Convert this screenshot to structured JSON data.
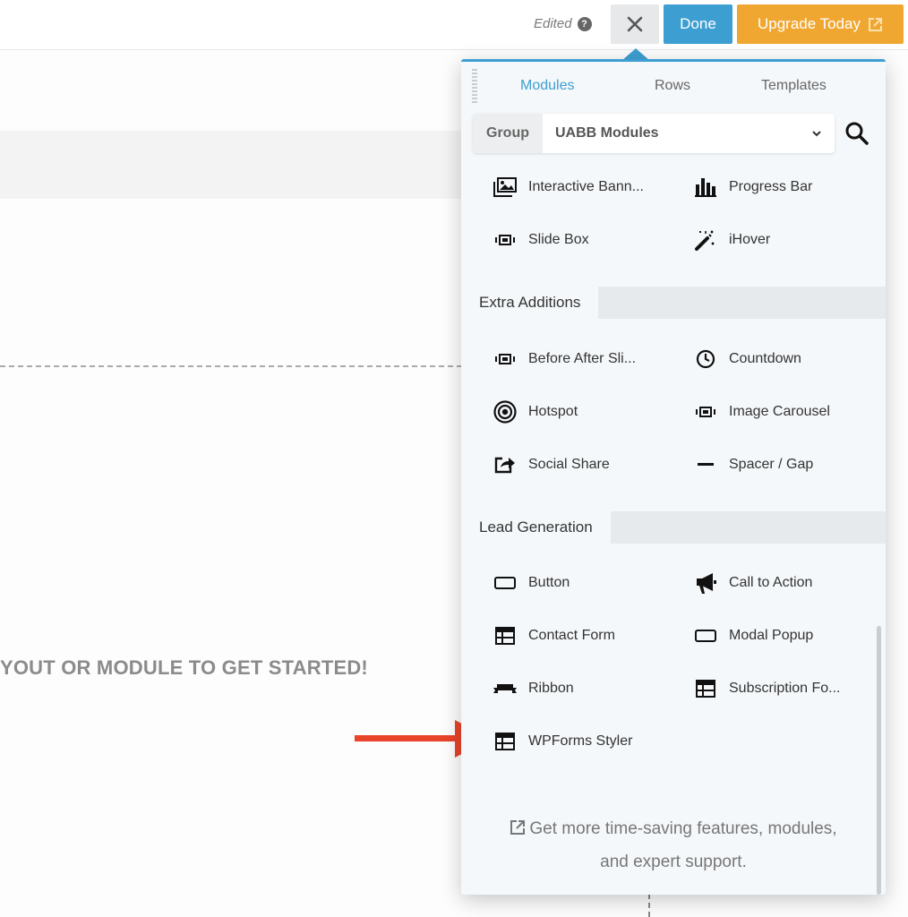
{
  "topbar": {
    "edited_label": "Edited",
    "help_icon_glyph": "?",
    "done_label": "Done",
    "upgrade_label": "Upgrade Today",
    "colors": {
      "done": "#3d9fd1",
      "upgrade": "#f0a732",
      "close": "#e6e8ea"
    }
  },
  "canvas": {
    "get_started_text": "YOUT OR MODULE TO GET STARTED!"
  },
  "panel": {
    "tabs": [
      {
        "label": "Modules",
        "active": true
      },
      {
        "label": "Rows",
        "active": false
      },
      {
        "label": "Templates",
        "active": false
      }
    ],
    "group_label": "Group",
    "group_value": "UABB Modules",
    "modules_top": [
      {
        "label": "Interactive Bann...",
        "icon": "image-icon"
      },
      {
        "label": "Progress Bar",
        "icon": "bar-chart-icon"
      },
      {
        "label": "Slide Box",
        "icon": "slider-icon"
      },
      {
        "label": "iHover",
        "icon": "magic-wand-icon"
      }
    ],
    "sections": [
      {
        "title": "Extra Additions",
        "items": [
          {
            "label": "Before After Sli...",
            "icon": "slider-icon"
          },
          {
            "label": "Countdown",
            "icon": "clock-icon"
          },
          {
            "label": "Hotspot",
            "icon": "target-icon"
          },
          {
            "label": "Image Carousel",
            "icon": "slider-icon"
          },
          {
            "label": "Social Share",
            "icon": "share-icon"
          },
          {
            "label": "Spacer / Gap",
            "icon": "minus-icon"
          }
        ]
      },
      {
        "title": "Lead Generation",
        "items": [
          {
            "label": "Button",
            "icon": "button-icon"
          },
          {
            "label": "Call to Action",
            "icon": "megaphone-icon"
          },
          {
            "label": "Contact Form",
            "icon": "table-icon"
          },
          {
            "label": "Modal Popup",
            "icon": "button-icon"
          },
          {
            "label": "Ribbon",
            "icon": "ribbon-icon"
          },
          {
            "label": "Subscription Fo...",
            "icon": "table-icon"
          },
          {
            "label": "WPForms Styler",
            "icon": "table-icon"
          }
        ]
      }
    ],
    "promo_line1": "Get more time-saving features, modules,",
    "promo_line2": "and expert support."
  },
  "arrow_color": "#e8452a"
}
